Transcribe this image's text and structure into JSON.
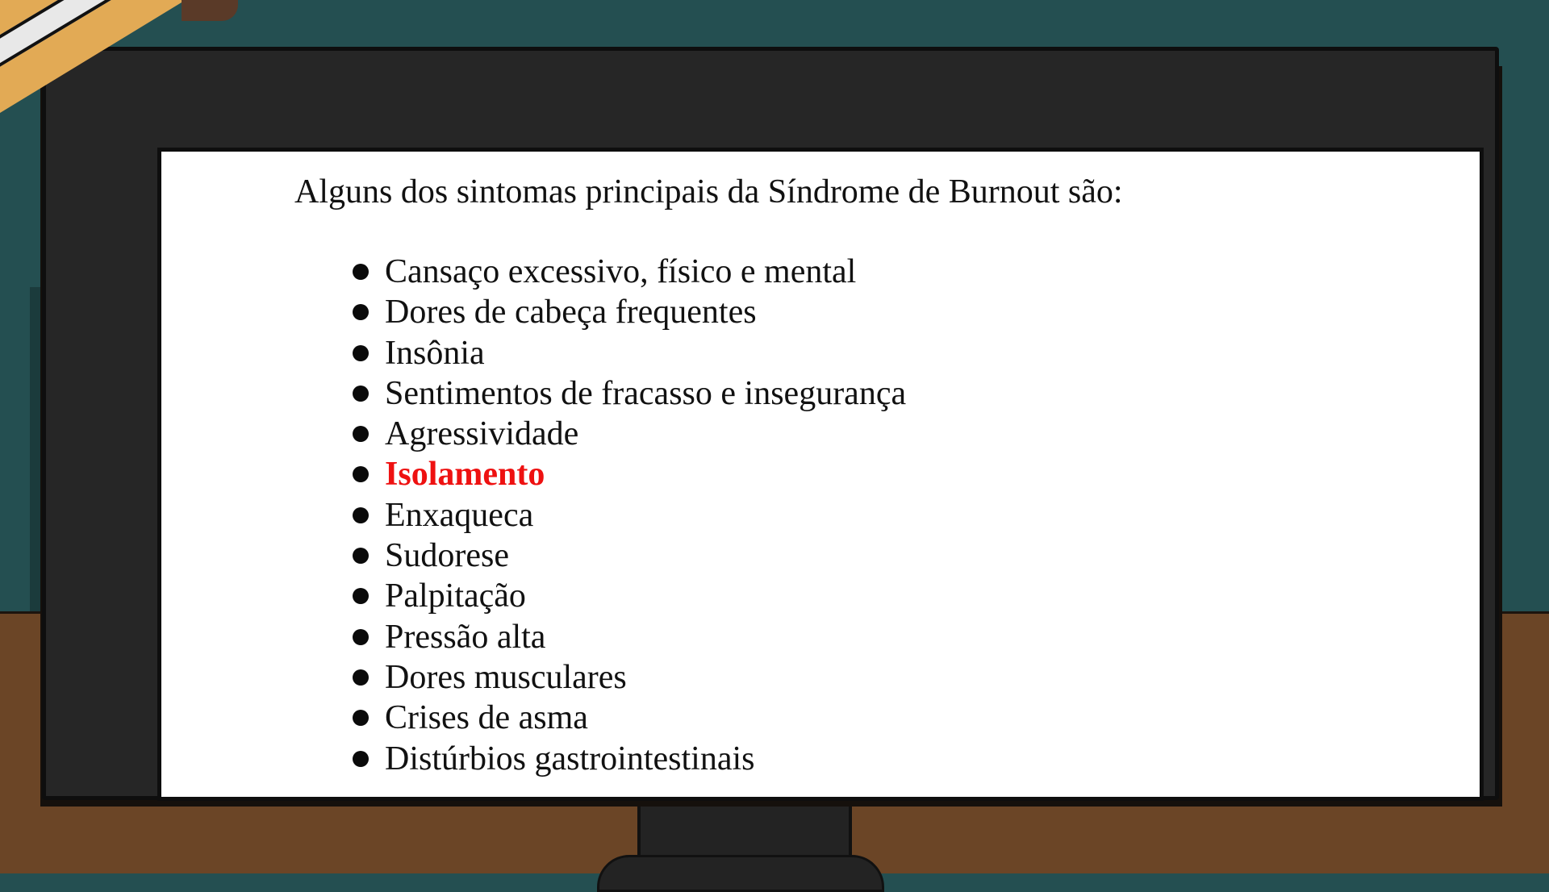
{
  "slide": {
    "heading": "Alguns dos sintomas principais da Síndrome de Burnout são:",
    "items": [
      {
        "text": "Cansaço excessivo, físico e mental",
        "highlight": false
      },
      {
        "text": "Dores de cabeça frequentes",
        "highlight": false
      },
      {
        "text": "Insônia",
        "highlight": false
      },
      {
        "text": "Sentimentos de fracasso e insegurança",
        "highlight": false
      },
      {
        "text": "Agressividade",
        "highlight": false
      },
      {
        "text": "Isolamento",
        "highlight": true
      },
      {
        "text": "Enxaqueca",
        "highlight": false
      },
      {
        "text": "Sudorese",
        "highlight": false
      },
      {
        "text": "Palpitação",
        "highlight": false
      },
      {
        "text": "Pressão alta",
        "highlight": false
      },
      {
        "text": "Dores musculares",
        "highlight": false
      },
      {
        "text": "Crises de asma",
        "highlight": false
      },
      {
        "text": "Distúrbios gastrointestinais",
        "highlight": false
      }
    ]
  },
  "colors": {
    "wall": "#244f51",
    "desk": "#6b4526",
    "monitor": "#262626",
    "screen": "#ffffff",
    "highlight": "#ee1111"
  }
}
